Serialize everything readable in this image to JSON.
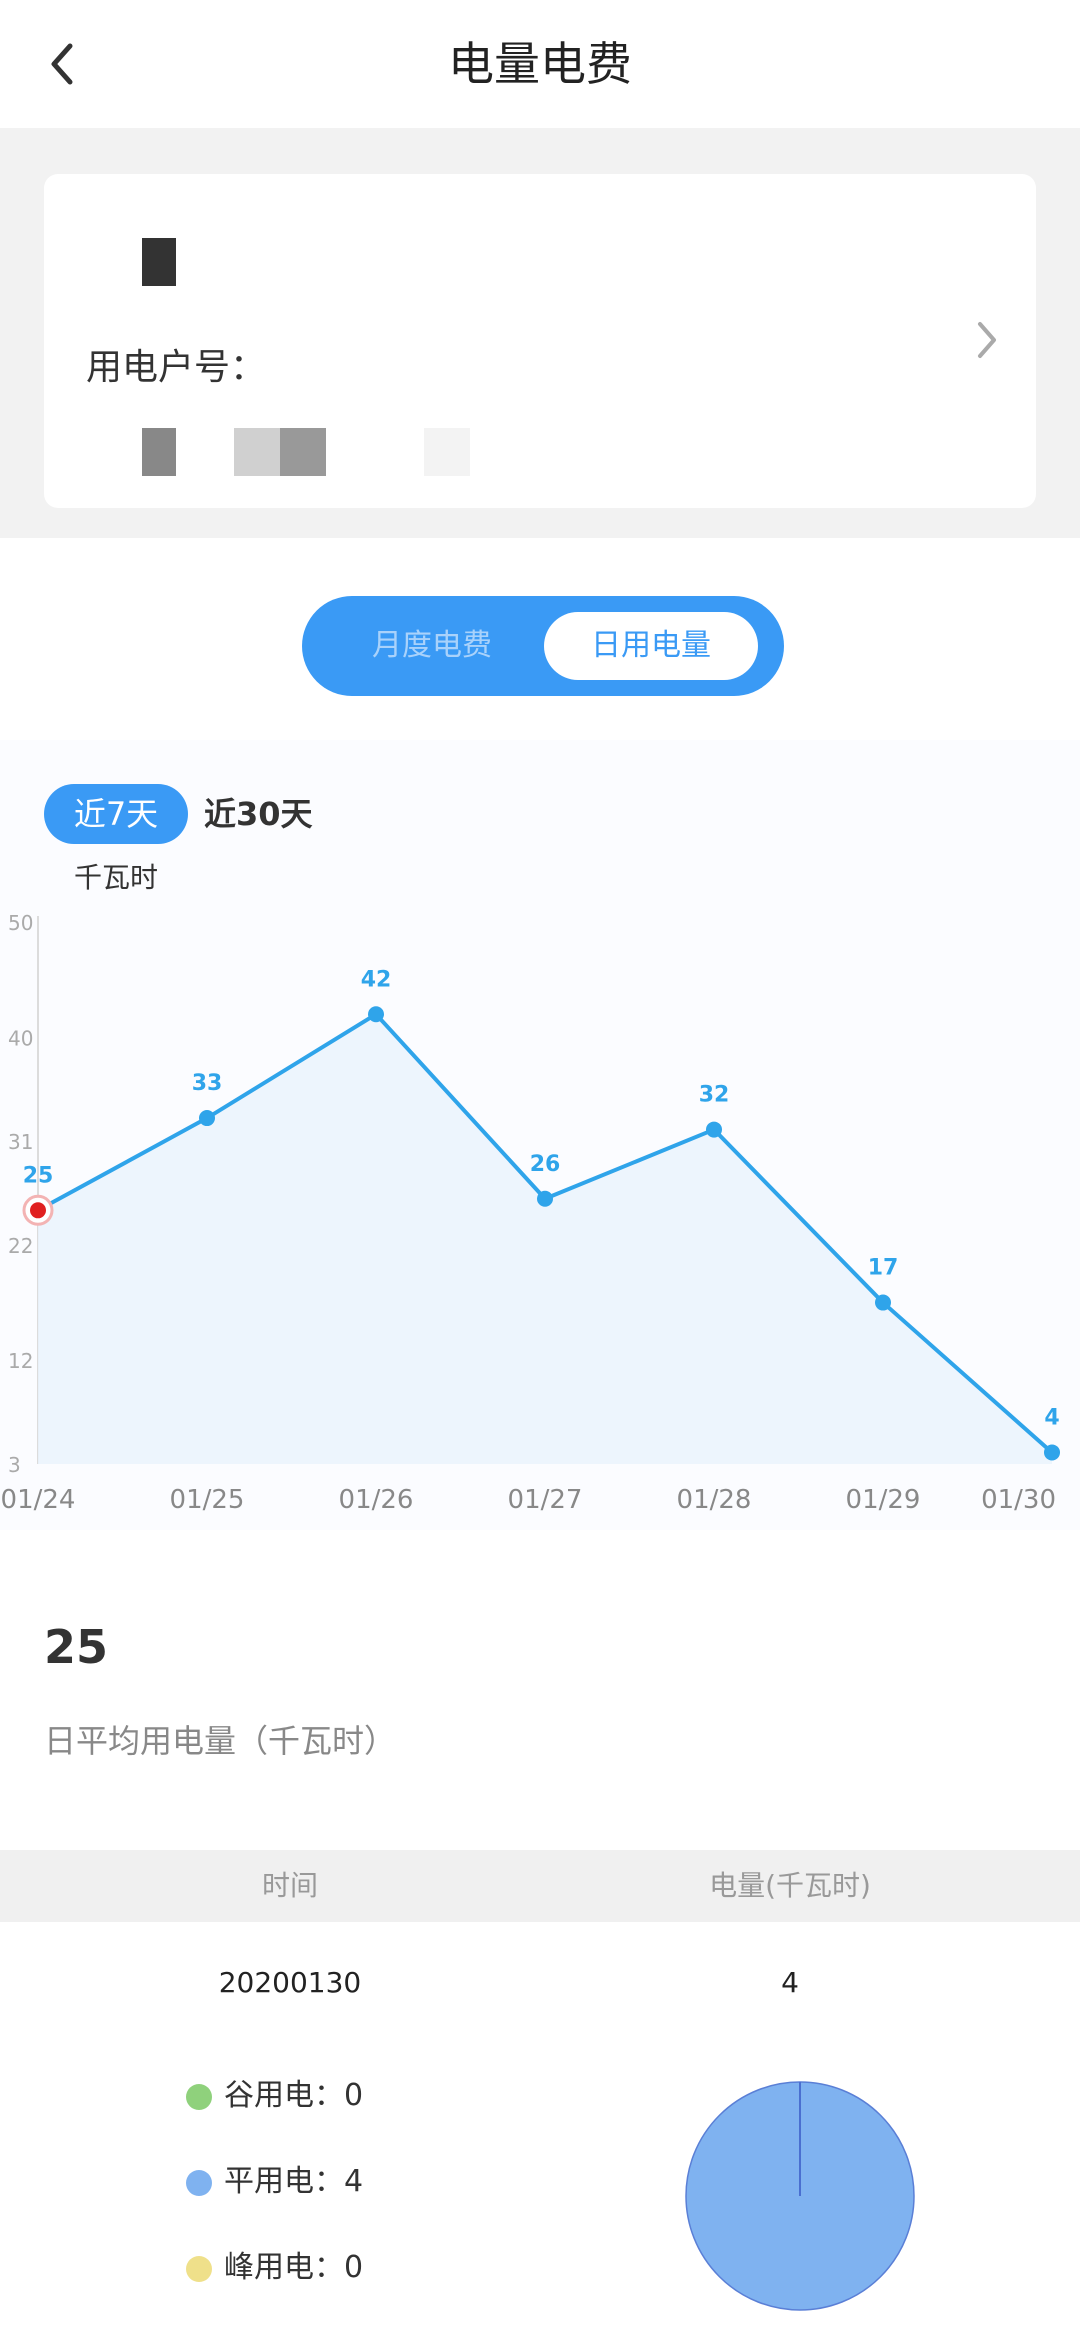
{
  "header": {
    "title": "电量电费",
    "back_icon": "chevron-left-icon"
  },
  "account": {
    "label": "用电户号：",
    "chevron_icon": "chevron-right-icon"
  },
  "tabs": {
    "month_label": "月度电费",
    "day_label": "日用电量",
    "active": "日用电量",
    "accent_color": "#3a9af5"
  },
  "range": {
    "near7_label": "近7天",
    "near30_label": "近30天",
    "active": "近7天"
  },
  "chart": {
    "unit": "千瓦时"
  },
  "chart_data": {
    "type": "area",
    "x": [
      "01/24",
      "01/25",
      "01/26",
      "01/27",
      "01/28",
      "01/29",
      "01/30"
    ],
    "series": [
      {
        "values": [
          25,
          33,
          42,
          26,
          32,
          17,
          4
        ]
      }
    ],
    "yticks": [
      3,
      12,
      22,
      31,
      40,
      50
    ],
    "ylim": [
      3,
      50
    ],
    "ylabel": "千瓦时",
    "highlight_index": 0,
    "line_color": "#2fa4ea",
    "highlight_color": "#e02020"
  },
  "average": {
    "value": "25",
    "label": "日平均用电量（千瓦时）"
  },
  "table": {
    "col_time": "时间",
    "col_energy": "电量(千瓦时)",
    "row": {
      "date": "20200130",
      "value": "4"
    }
  },
  "breakdown": {
    "items": [
      {
        "label": "谷用电：",
        "value": "0",
        "color": "#8fd17c"
      },
      {
        "label": "平用电：",
        "value": "4",
        "color": "#7fb2f0"
      },
      {
        "label": "峰用电：",
        "value": "0",
        "color": "#efe08a"
      }
    ]
  }
}
